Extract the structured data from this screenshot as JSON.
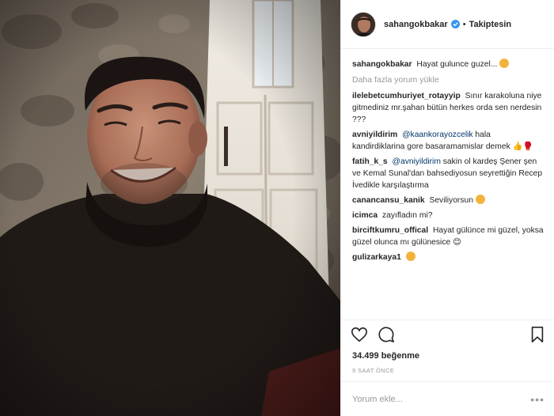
{
  "post": {
    "username": "sahangokbakar",
    "follow_status": "Takiptesin",
    "caption": "Hayat gulunce guzel...",
    "load_more": "Daha fazla yorum yükle",
    "comments": [
      {
        "user": "ilelebetcumhuriyet_rotayyip",
        "text": "Sınır karakoluna niye gitmediniz mr.şahan bütün herkes orda sen nerdesin ???"
      },
      {
        "user": "avniyildirim",
        "mention": "@kaankorayozcelik",
        "text": "hala kandirdiklarina gore basaramamislar demek"
      },
      {
        "user": "fatih_k_s",
        "mention": "@avniyildirim",
        "text": "sakin ol kardeş Şener şen ve Kemal Sunal'dan bahsediyosun seyrettiğin Recep İvedikle karşılaştırma"
      },
      {
        "user": "canancansu_kanik",
        "text": "Seviliyorsun"
      },
      {
        "user": "icimca",
        "text": "zayıfladın mi?"
      },
      {
        "user": "birciftkumru_offical",
        "text": "Hayat gülünce mi güzel, yoksa güzel olunca mı gülünesice 😊"
      },
      {
        "user": "gulizarkaya1",
        "text": ""
      }
    ],
    "likes": "34.499 beğenme",
    "time": "9 SAAT ÖNCE",
    "comment_placeholder": "Yorum ekle...",
    "more_options": "•••"
  },
  "icons": [
    "verified-badge-icon",
    "heart-icon",
    "comment-icon",
    "bookmark-icon",
    "more-icon"
  ],
  "colors": {
    "verified": "#3897f0",
    "mention": "#003569",
    "muted": "#999999",
    "emoji": "#f2b33d"
  }
}
